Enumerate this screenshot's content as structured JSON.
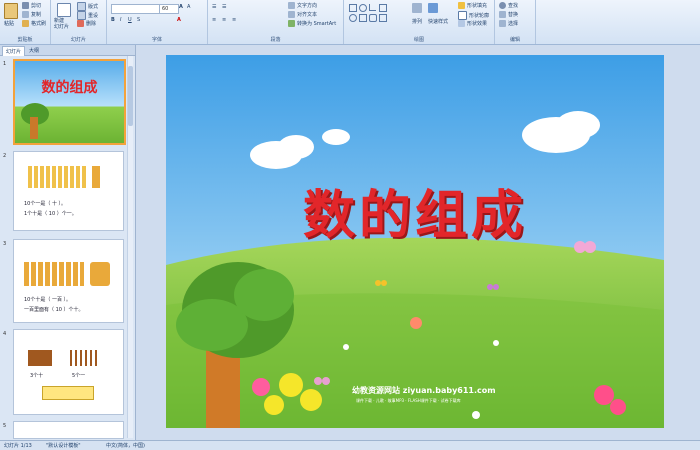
{
  "ribbon": {
    "clipboard": {
      "paste": "粘贴",
      "cut": "剪切",
      "copy": "复制",
      "format_painter": "格式刷",
      "label": "剪贴板"
    },
    "slides": {
      "new_slide": "新建\n幻灯片",
      "layout": "版式",
      "reset": "重设",
      "delete": "删除",
      "label": "幻灯片"
    },
    "font": {
      "size_value": "60",
      "label": "字体"
    },
    "paragraph": {
      "text_direction": "文字方向",
      "align_text": "对齐文本",
      "smartart": "转换为 SmartArt",
      "label": "段落"
    },
    "drawing": {
      "arrange": "排列",
      "quick_styles": "快速样式",
      "shape_fill": "形状填充",
      "shape_outline": "形状轮廓",
      "shape_effects": "形状效果",
      "label": "绘图"
    },
    "editing": {
      "find": "查找",
      "replace": "替换",
      "select": "选择",
      "label": "编辑"
    }
  },
  "pane": {
    "tabs": [
      "幻灯片",
      "大纲"
    ],
    "thumb_numbers": [
      "1",
      "2",
      "3",
      "4",
      "5"
    ],
    "thumb1_title": "数的组成",
    "thumb2_lines": [
      "10个一是（ 十 ）。",
      "1个十是（ 10 ）个一。"
    ],
    "thumb3_lines": [
      "10个十是（ 一百 ）。",
      "一百里面有（ 10 ）个十。"
    ],
    "thumb4_lines": [
      "3个十",
      "5个一"
    ]
  },
  "slide": {
    "title": "数的组成",
    "site": "幼教资源网站  ziyuan.baby611.com",
    "site_sub": "课件下载 · 儿歌 · 故事MP3 · FLASH课件下载 · 试卷下载库"
  },
  "status": {
    "slide_count": "幻灯片 1/13",
    "theme": "\"默认设计模板\"",
    "language": "中文(简体，中国)"
  },
  "colors": {
    "title_red": "#e2262a",
    "sky_top": "#4aa3e6",
    "grass": "#7cc13a",
    "selected_border": "#f3a23b"
  }
}
